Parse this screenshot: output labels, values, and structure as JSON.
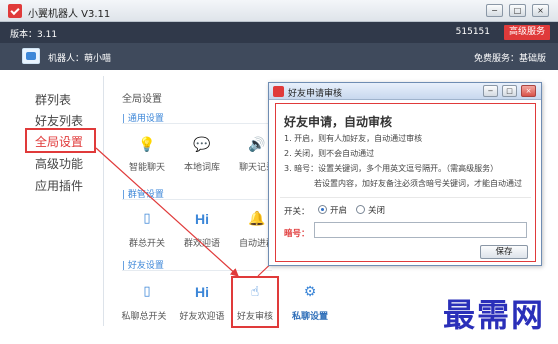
{
  "window": {
    "title": "小翼机器人 V3.11",
    "minimize_label": "−",
    "maximize_label": "□",
    "close_label": "×"
  },
  "version_bar": {
    "version_text": "版本：3.11",
    "user_id": "515151",
    "premium_button": "高级服务"
  },
  "robot_bar": {
    "robot_name": "机器人：萌小喵",
    "service_text": "免费服务：基础版"
  },
  "nav": {
    "items": [
      {
        "label": "群列表",
        "active": false
      },
      {
        "label": "好友列表",
        "active": false
      },
      {
        "label": "全局设置",
        "active": true
      },
      {
        "label": "高级功能",
        "active": false
      },
      {
        "label": "应用插件",
        "active": false
      }
    ]
  },
  "content": {
    "title": "全局设置",
    "sections": [
      {
        "label": "| 通用设置",
        "features": [
          {
            "label": "智能聊天",
            "icon": "bulb-icon"
          },
          {
            "label": "本地词库",
            "icon": "chat-bubble-icon"
          },
          {
            "label": "聊天记录",
            "icon": "speaker-icon"
          }
        ]
      },
      {
        "label": "| 群管设置",
        "features": [
          {
            "label": "群总开关",
            "icon": "phone-icon"
          },
          {
            "label": "群欢迎语",
            "icon": "hi-icon",
            "icon_text": "Hi"
          },
          {
            "label": "自动进群",
            "icon": "bell-icon"
          }
        ]
      },
      {
        "label": "| 好友设置",
        "features": [
          {
            "label": "私聊总开关",
            "icon": "phone-icon"
          },
          {
            "label": "好友欢迎语",
            "icon": "hi-icon",
            "icon_text": "Hi"
          },
          {
            "label": "好友审核",
            "icon": "hand-pointer-icon"
          },
          {
            "label": "私聊设置",
            "icon": "gear-icon"
          }
        ]
      }
    ]
  },
  "dialog": {
    "title": "好友申请审核",
    "heading": "好友申请，自动审核",
    "rules": [
      "1. 开启，则有人加好友，自动通过审核",
      "2. 关闭，则不会自动通过",
      "3. 暗号：设置关键词，多个用英文逗号隔开。（需高级服务）",
      "若设置内容，加好友备注必须含暗号关键词，才能自动通过"
    ],
    "switch_label": "开关：",
    "option_on": "开启",
    "option_off": "关闭",
    "selected_option": "开启",
    "code_label": "暗号：",
    "code_value": "",
    "save_button": "保存"
  },
  "watermark": "最需网",
  "colors": {
    "accent_red": "#e03a3a",
    "accent_blue": "#3d87d8",
    "dark_bar": "#30394a"
  }
}
